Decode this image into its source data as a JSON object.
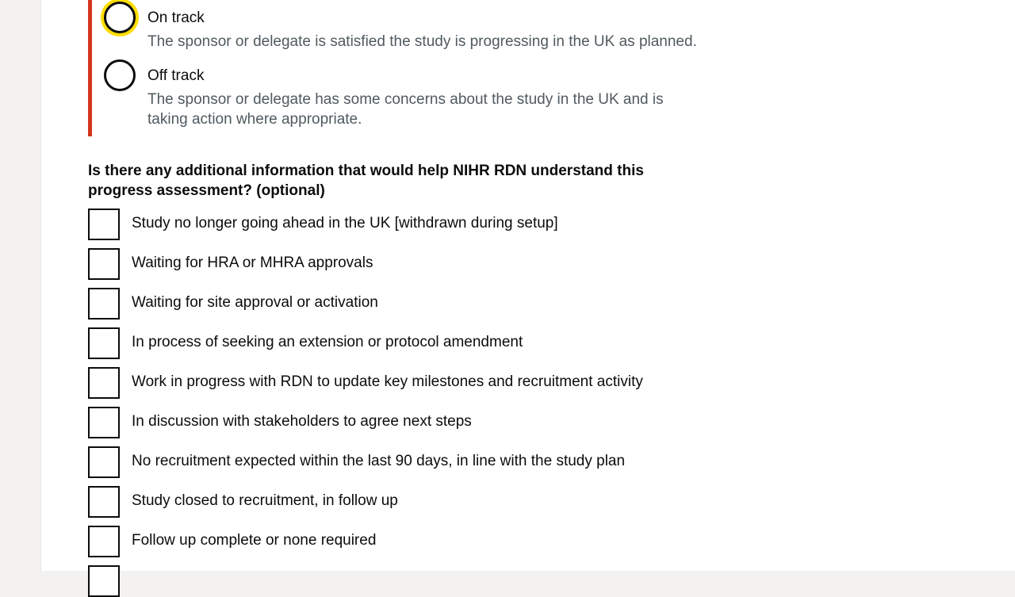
{
  "progress_status": {
    "options": [
      {
        "label": "On track",
        "hint": "The sponsor or delegate is satisfied the study is progressing in the UK as planned."
      },
      {
        "label": "Off track",
        "hint": "The sponsor or delegate has some concerns about the study in the UK and is taking action where appropriate."
      }
    ]
  },
  "additional_info": {
    "question": "Is there any additional information that would help NIHR RDN understand this progress assessment? (optional)",
    "options": [
      "Study no longer going ahead in the UK [withdrawn during setup]",
      "Waiting for HRA or MHRA approvals",
      "Waiting for site approval or activation",
      "In process of seeking an extension or protocol amendment",
      "Work in progress with RDN to update key milestones and recruitment activity",
      "In discussion with stakeholders to agree next steps",
      "No recruitment expected within the last 90 days, in line with the study plan",
      "Study closed to recruitment, in follow up",
      "Follow up complete or none required"
    ]
  },
  "colors": {
    "error_border": "#d4351c",
    "focus": "#ffdd00",
    "text": "#0b0c0c",
    "hint": "#505a5f"
  }
}
